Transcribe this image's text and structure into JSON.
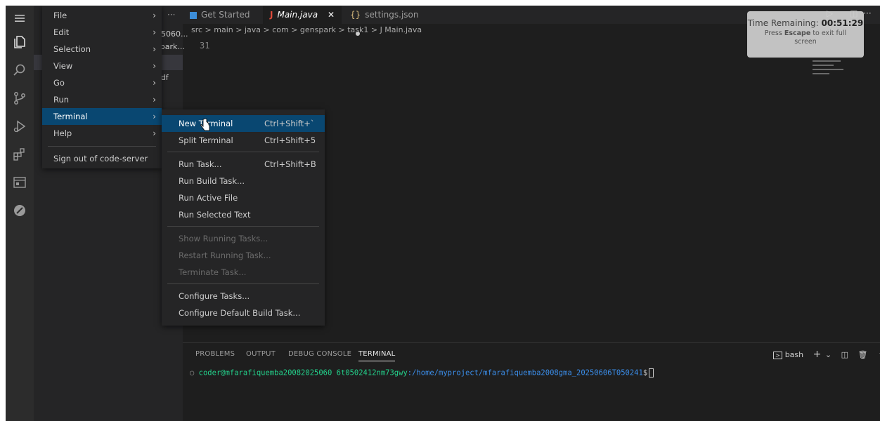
{
  "colors": {
    "accent": "#094771",
    "terminal_user": "#23d18b",
    "terminal_path": "#3b8eea"
  },
  "activity_bar": {
    "icons": [
      "menu-icon",
      "files-icon",
      "search-icon",
      "source-control-icon",
      "run-debug-icon",
      "extensions-icon",
      "remote-explorer-icon",
      "settings-icon"
    ]
  },
  "sidebar": {
    "rows": [
      "25060...",
      "spark...",
      "",
      "odf"
    ]
  },
  "tabs": [
    {
      "label": "···"
    },
    {
      "label": "Get Started"
    },
    {
      "label": "Main.java",
      "active": true
    },
    {
      "label": "settings.json",
      "modified": true
    }
  ],
  "breadcrumb": "src > main > java > com > genspark > task1 > J  Main.java",
  "editor": {
    "line_number": "31"
  },
  "main_menu": {
    "items": [
      "File",
      "Edit",
      "Selection",
      "View",
      "Go",
      "Run",
      "Terminal",
      "Help"
    ],
    "signout": "Sign out of code-server"
  },
  "terminal_menu": {
    "items": [
      {
        "label": "New Terminal",
        "kb": "Ctrl+Shift+`"
      },
      {
        "label": "Split Terminal",
        "kb": "Ctrl+Shift+5"
      },
      {
        "label": "Run Task...",
        "kb": "Ctrl+Shift+B"
      },
      {
        "label": "Run Build Task...",
        "kb": ""
      },
      {
        "label": "Run Active File",
        "kb": ""
      },
      {
        "label": "Run Selected Text",
        "kb": ""
      },
      {
        "label": "Show Running Tasks...",
        "kb": ""
      },
      {
        "label": "Restart Running Task...",
        "kb": ""
      },
      {
        "label": "Terminate Task...",
        "kb": ""
      },
      {
        "label": "Configure Tasks...",
        "kb": ""
      },
      {
        "label": "Configure Default Build Task...",
        "kb": ""
      }
    ]
  },
  "panel": {
    "tabs": [
      "PROBLEMS",
      "OUTPUT",
      "DEBUG CONSOLE",
      "TERMINAL"
    ],
    "shell_label": "bash",
    "terminal": {
      "user": "coder@mfarafiquemba20082025060 6t0502412nm73gwy",
      "path": ":/home/myproject/mfarafiquemba2008gma_20250606T050241",
      "dollar": "$"
    }
  },
  "timer": {
    "label": "Time Remaining:",
    "value": "00:51:29",
    "hint_prefix": "Press",
    "hint_key": "Escape",
    "hint_suffix": "to exit full screen"
  }
}
